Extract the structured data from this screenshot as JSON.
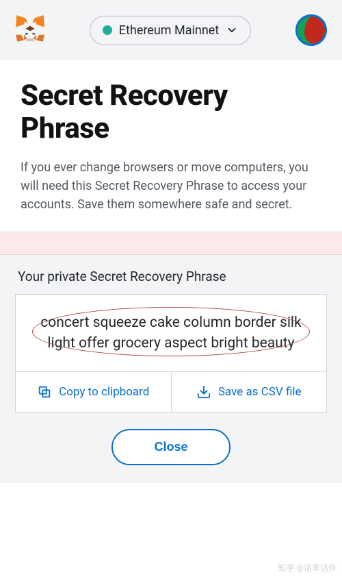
{
  "header": {
    "network_label": "Ethereum Mainnet"
  },
  "main": {
    "title": "Secret Recovery Phrase",
    "description": "If you ever change browsers or move computers, you will need this Secret Recovery Phrase to access your accounts. Save them somewhere safe and secret."
  },
  "phrase": {
    "label": "Your private Secret Recovery Phrase",
    "words": "concert squeeze cake column border silk light offer grocery aspect bright beauty"
  },
  "actions": {
    "copy_label": "Copy to clipboard",
    "save_csv_label": "Save as CSV file",
    "close_label": "Close"
  },
  "watermark": "知乎 @话李话外"
}
